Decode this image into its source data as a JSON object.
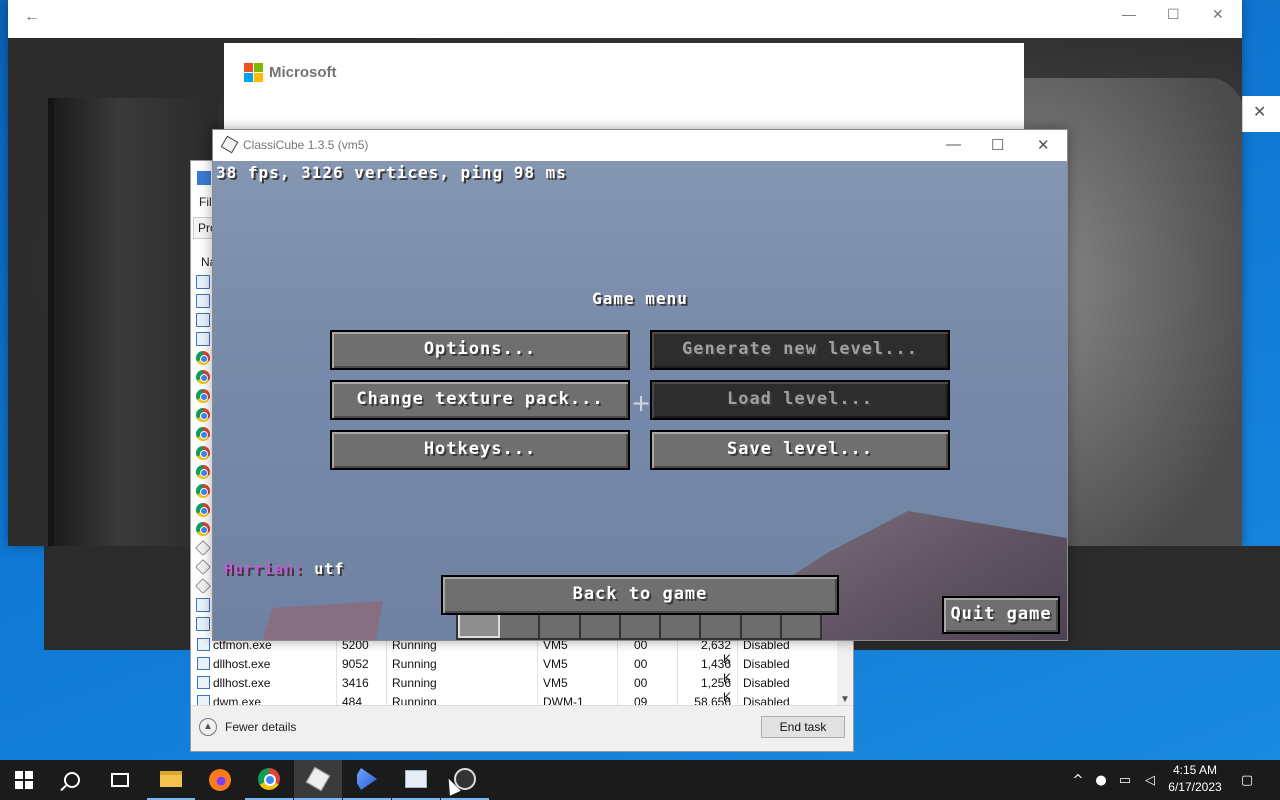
{
  "photo_window": {
    "back_icon": "back-arrow-icon",
    "brand": "Microsoft",
    "controls": [
      "minimize-icon",
      "maximize-icon",
      "close-icon"
    ]
  },
  "side_dialog": {
    "close_glyph": "✕"
  },
  "task_manager": {
    "menu_first": "File",
    "tab_first": "Pro",
    "column_first": "Na",
    "rows": [
      {
        "name": "ctfmon.exe",
        "pid": "5200",
        "status": "Running",
        "user": "VM5",
        "cpu": "00",
        "memory": "2,632 K",
        "uac": "Disabled"
      },
      {
        "name": "dllhost.exe",
        "pid": "9052",
        "status": "Running",
        "user": "VM5",
        "cpu": "00",
        "memory": "1,436 K",
        "uac": "Disabled"
      },
      {
        "name": "dllhost.exe",
        "pid": "3416",
        "status": "Running",
        "user": "VM5",
        "cpu": "00",
        "memory": "1,256 K",
        "uac": "Disabled"
      },
      {
        "name": "dwm.exe",
        "pid": "484",
        "status": "Running",
        "user": "DWM-1",
        "cpu": "09",
        "memory": "58,656 K",
        "uac": "Disabled"
      }
    ],
    "fewer_details": "Fewer details",
    "end_task": "End task"
  },
  "classicube": {
    "title": "ClassiCube 1.3.5 (vm5)",
    "stats": "38 fps, 3126 vertices, ping 98 ms",
    "menu_title": "Game menu",
    "buttons": {
      "options": "Options...",
      "generate": "Generate new level...",
      "texture": "Change texture pack...",
      "load": "Load level...",
      "hotkeys": "Hotkeys...",
      "save": "Save level...",
      "back": "Back to game",
      "quit": "Quit game"
    },
    "chat": {
      "name": "Hurrian:",
      "message": " utf"
    }
  },
  "taskbar": {
    "apps": [
      "start",
      "search",
      "task-view",
      "file-explorer",
      "firefox",
      "chrome",
      "classicube",
      "media-player",
      "task-manager",
      "obs"
    ],
    "time": "4:15 AM",
    "date": "6/17/2023"
  }
}
